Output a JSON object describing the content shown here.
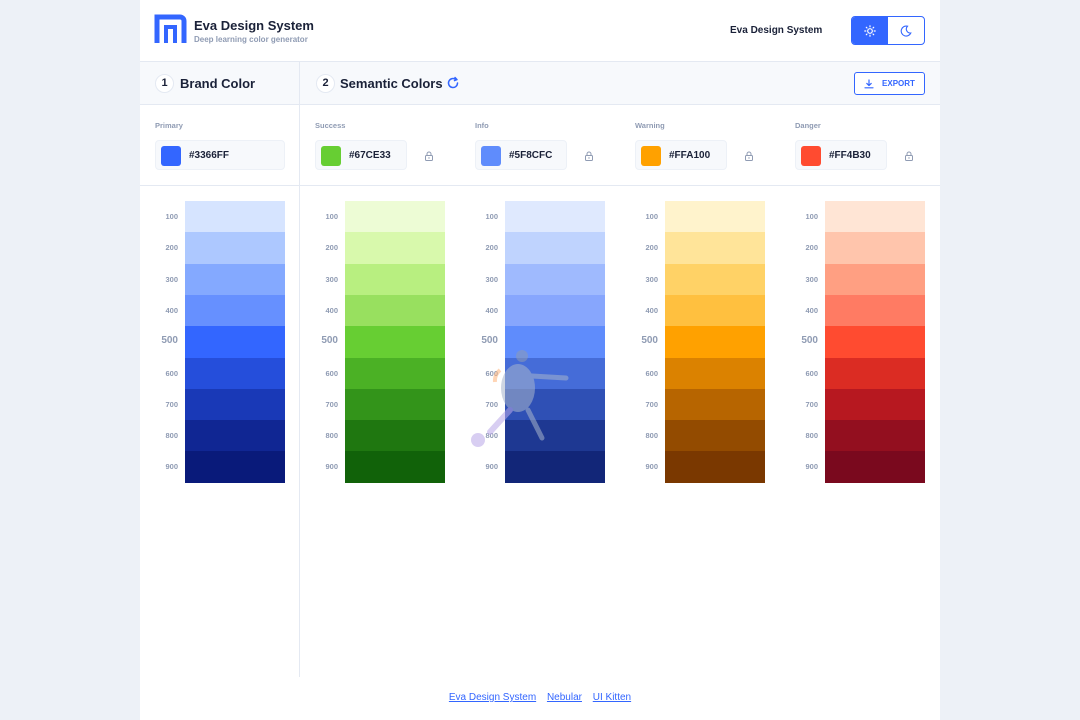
{
  "header": {
    "title": "Eva Design System",
    "subtitle": "Deep learning color generator",
    "nav_link": "Eva Design System",
    "theme": {
      "light_icon": "sun-icon",
      "dark_icon": "moon-icon",
      "active": "light"
    }
  },
  "steps": {
    "brand": {
      "number": "1",
      "title": "Brand Color"
    },
    "semantic": {
      "number": "2",
      "title": "Semantic Colors"
    },
    "export_label": "EXPORT"
  },
  "colors": [
    {
      "label": "Primary",
      "hex": "#3366FF",
      "locked_icon": false,
      "shades": [
        "#D6E4FF",
        "#ADC8FF",
        "#84A9FF",
        "#6690FF",
        "#3366FF",
        "#254EDB",
        "#1939B7",
        "#102693",
        "#091A7A"
      ]
    },
    {
      "label": "Success",
      "hex": "#67CE33",
      "locked_icon": true,
      "shades": [
        "#EDFCD5",
        "#D8F9AC",
        "#B8EF80",
        "#98E05F",
        "#67CE33",
        "#4BB125",
        "#33941A",
        "#1F7710",
        "#116209"
      ]
    },
    {
      "label": "Info",
      "hex": "#5F8CFC",
      "locked_icon": true,
      "shades": [
        "#DFE9FE",
        "#BFD3FE",
        "#9FBAFE",
        "#87A6FD",
        "#5F8CFC",
        "#456CD8",
        "#2F50B5",
        "#1E3892",
        "#122678"
      ]
    },
    {
      "label": "Warning",
      "hex": "#FFA100",
      "locked_icon": true,
      "shades": [
        "#FFF3CC",
        "#FFE499",
        "#FFD266",
        "#FFC03F",
        "#FFA100",
        "#DB8200",
        "#B76500",
        "#934B00",
        "#7A3800"
      ]
    },
    {
      "label": "Danger",
      "hex": "#FF4B30",
      "locked_icon": true,
      "shades": [
        "#FFE5D5",
        "#FFC5AC",
        "#FF9F82",
        "#FF7B63",
        "#FF4B30",
        "#DB2C23",
        "#B71820",
        "#930F1F",
        "#7A091E"
      ]
    }
  ],
  "shade_levels": [
    "100",
    "200",
    "300",
    "400",
    "500",
    "600",
    "700",
    "800",
    "900"
  ],
  "footer": {
    "links": [
      "Eva Design System",
      "Nebular",
      "UI Kitten"
    ]
  }
}
